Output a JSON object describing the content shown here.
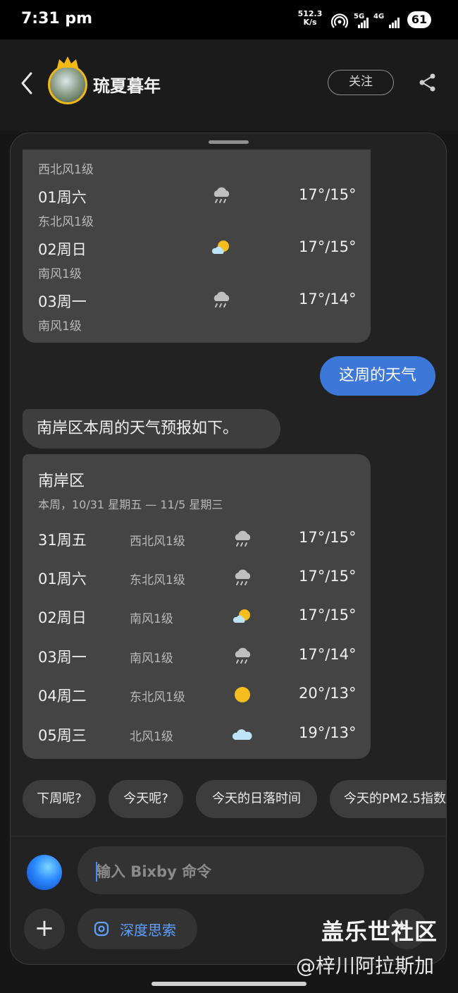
{
  "status_bar": {
    "time": "7:31 pm",
    "net_speed_value": "512.3",
    "net_speed_unit": "K/s",
    "signal_5g": "5G",
    "signal_4g": "4G",
    "battery": "61"
  },
  "header": {
    "author_name": "琉夏暮年",
    "follow_label": "关注"
  },
  "top_card": {
    "partial_wind": "西北风1级",
    "rows": [
      {
        "day": "01周六",
        "wind": "东北风1级",
        "temp": "17°/15°",
        "icon": "rain-cloud-icon"
      },
      {
        "day": "02周日",
        "wind": "南风1级",
        "temp": "17°/15°",
        "icon": "sun-behind-cloud-icon"
      },
      {
        "day": "03周一",
        "wind": "南风1级",
        "temp": "17°/14°",
        "icon": "rain-cloud-icon"
      }
    ]
  },
  "user_message": "这周的天气",
  "bot_message": "南岸区本周的天气预报如下。",
  "forecast": {
    "location": "南岸区",
    "range": "本周，10/31 星期五 — 11/5 星期三",
    "rows": [
      {
        "day": "31周五",
        "wind": "西北风1级",
        "temp": "17°/15°",
        "icon": "rain-cloud-icon"
      },
      {
        "day": "01周六",
        "wind": "东北风1级",
        "temp": "17°/15°",
        "icon": "rain-cloud-icon"
      },
      {
        "day": "02周日",
        "wind": "南风1级",
        "temp": "17°/15°",
        "icon": "sun-behind-cloud-icon"
      },
      {
        "day": "03周一",
        "wind": "南风1级",
        "temp": "17°/14°",
        "icon": "rain-cloud-icon"
      },
      {
        "day": "04周二",
        "wind": "东北风1级",
        "temp": "20°/13°",
        "icon": "sun-icon"
      },
      {
        "day": "05周三",
        "wind": "北风1级",
        "temp": "19°/13°",
        "icon": "cloud-icon"
      }
    ]
  },
  "suggestions": [
    "下周呢?",
    "今天呢?",
    "今天的日落时间",
    "今天的PM2.5指数"
  ],
  "input": {
    "placeholder": "输入 Bixby 命令"
  },
  "deep_search_label": "深度思索",
  "watermark": {
    "line1": "盖乐世社区",
    "line2": "@梓川阿拉斯加"
  },
  "colors": {
    "accent_blue": "#3d78d8",
    "sun_yellow": "#f6bd1e",
    "card_bg": "#444444"
  }
}
